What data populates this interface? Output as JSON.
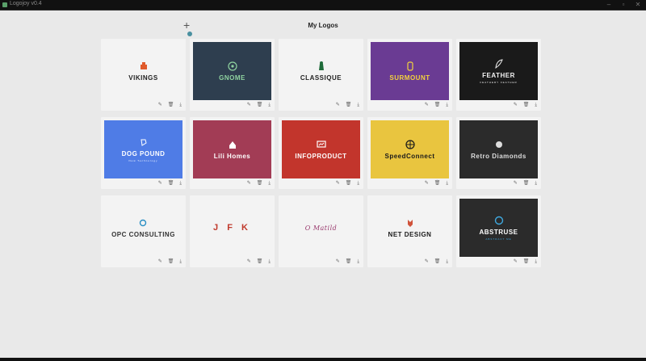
{
  "app": {
    "title": "Logojoy v0.4"
  },
  "page": {
    "title": "My Logos"
  },
  "actions": {
    "edit": "✎",
    "delete": "🗑",
    "download": "⤓"
  },
  "logos": [
    {
      "name": "VIKINGS",
      "tagline": "",
      "bg": "#f3f3f3",
      "fg": "#222222",
      "accent": "#e05a2b"
    },
    {
      "name": "GNOME",
      "tagline": "",
      "bg": "#2e3e4f",
      "fg": "#8fd3a0",
      "accent": "#8fd3a0"
    },
    {
      "name": "CLASSIQUE",
      "tagline": "",
      "bg": "#f3f3f3",
      "fg": "#222222",
      "accent": "#1f6b3a"
    },
    {
      "name": "SURMOUNT",
      "tagline": "",
      "bg": "#6a3b93",
      "fg": "#f2d33c",
      "accent": "#f2d33c"
    },
    {
      "name": "FEATHER",
      "tagline": "FEATHERY FEATHER",
      "bg": "#1a1a1a",
      "fg": "#f2f2f2",
      "accent": "#f2f2f2"
    },
    {
      "name": "DOG POUND",
      "tagline": "New Technology",
      "bg": "#4f7ce6",
      "fg": "#ffffff",
      "accent": "#ffffff"
    },
    {
      "name": "Lili Homes",
      "tagline": "",
      "bg": "#a23c55",
      "fg": "#ffffff",
      "accent": "#ffffff"
    },
    {
      "name": "INFOPRODUCT",
      "tagline": "",
      "bg": "#c2352c",
      "fg": "#ffffff",
      "accent": "#ffffff"
    },
    {
      "name": "SpeedConnect",
      "tagline": "",
      "bg": "#e9c53f",
      "fg": "#1a1a1a",
      "accent": "#1a1a1a"
    },
    {
      "name": "Retro Diamonds",
      "tagline": "",
      "bg": "#2b2b2b",
      "fg": "#dddddd",
      "accent": "#dddddd"
    },
    {
      "name": "OPC CONSULTING",
      "tagline": "",
      "bg": "#f3f3f3",
      "fg": "#333333",
      "accent": "#2a8fc4"
    },
    {
      "name": "J F K",
      "tagline": "",
      "bg": "#f3f3f3",
      "fg": "#c0392b",
      "accent": "#c0392b"
    },
    {
      "name": "O Matild",
      "tagline": "",
      "bg": "#f3f3f3",
      "fg": "#9a3a6e",
      "accent": "#9a3a6e"
    },
    {
      "name": "NET DESIGN",
      "tagline": "",
      "bg": "#f3f3f3",
      "fg": "#1a1a1a",
      "accent": "#d0523a"
    },
    {
      "name": "ABSTRUSE",
      "tagline": "ABSTRACT ME",
      "bg": "#2b2b2b",
      "fg": "#ffffff",
      "accent": "#3fa9e0"
    }
  ]
}
